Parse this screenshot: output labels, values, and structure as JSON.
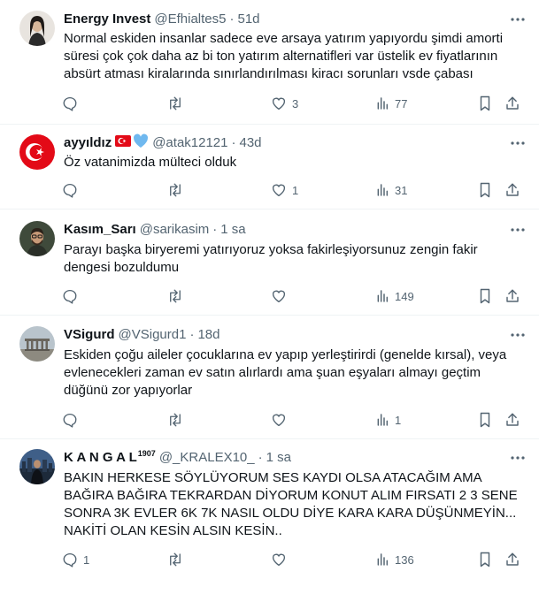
{
  "tweets": [
    {
      "name": "Energy Invest",
      "handle": "@Efhialtes5",
      "separator": "·",
      "time": "51d",
      "text": "Normal eskiden insanlar sadece eve arsaya yatırım yapıyordu şimdi amorti süresi çok çok daha az bi ton yatırım alternatifleri var üstelik ev fiyatlarının absürt atması kiralarında sınırlandırılması kiracı sorunları vsde çabası",
      "replies": "",
      "retweets": "",
      "likes": "3",
      "views": "77",
      "avatar_icon": "person-portrait"
    },
    {
      "name": "ayyıldız",
      "badges": [
        "turkey-flag-icon",
        "blue-heart-icon"
      ],
      "handle": "@atak12121",
      "separator": "·",
      "time": "43d",
      "text": "Öz vatanimizda mülteci olduk",
      "replies": "",
      "retweets": "",
      "likes": "1",
      "views": "31",
      "avatar_icon": "crescent-star"
    },
    {
      "name": "Kasım_Sarı",
      "handle": "@sarikasim",
      "separator": "·",
      "time": "1 sa",
      "text": "Parayı başka biryeremi yatırıyoruz yoksa fakirleşiyorsunuz zengin fakir dengesi bozuldumu",
      "replies": "",
      "retweets": "",
      "likes": "",
      "views": "149",
      "avatar_icon": "person-portrait"
    },
    {
      "name": "VSigurd",
      "handle": "@VSigurd1",
      "separator": "·",
      "time": "18d",
      "text": "Eskiden çoğu aileler çocuklarına ev yapıp yerleştirirdi (genelde kırsal), veya evlenecekleri zaman ev satın alırlardı ama şuan eşyaları almayı geçtim düğünü zor yapıyorlar",
      "replies": "",
      "retweets": "",
      "likes": "",
      "views": "1",
      "avatar_icon": "monument"
    },
    {
      "name": "K A N G A L",
      "name_sup": "1907",
      "handle": "@_KRALEX10_",
      "separator": "·",
      "time": "1 sa",
      "text": "BAKIN HERKESE SÖYLÜYORUM SES KAYDI OLSA ATACAĞIM AMA BAĞIRA BAĞIRA TEKRARDAN DİYORUM KONUT ALIM FIRSATI 2 3 SENE SONRA 3K EVLER 6K 7K NASIL OLDU DİYE KARA KARA DÜŞÜNMEYİN... NAKİTİ OLAN KESİN ALSIN KESİN..",
      "replies": "1",
      "retweets": "",
      "likes": "",
      "views": "136",
      "avatar_icon": "city-skyline"
    }
  ],
  "colors": {
    "text": "#0f1419",
    "muted": "#536471",
    "divider": "#eff3f4",
    "flag_red": "#e30a17",
    "heart_blue": "#6fb8ef"
  }
}
